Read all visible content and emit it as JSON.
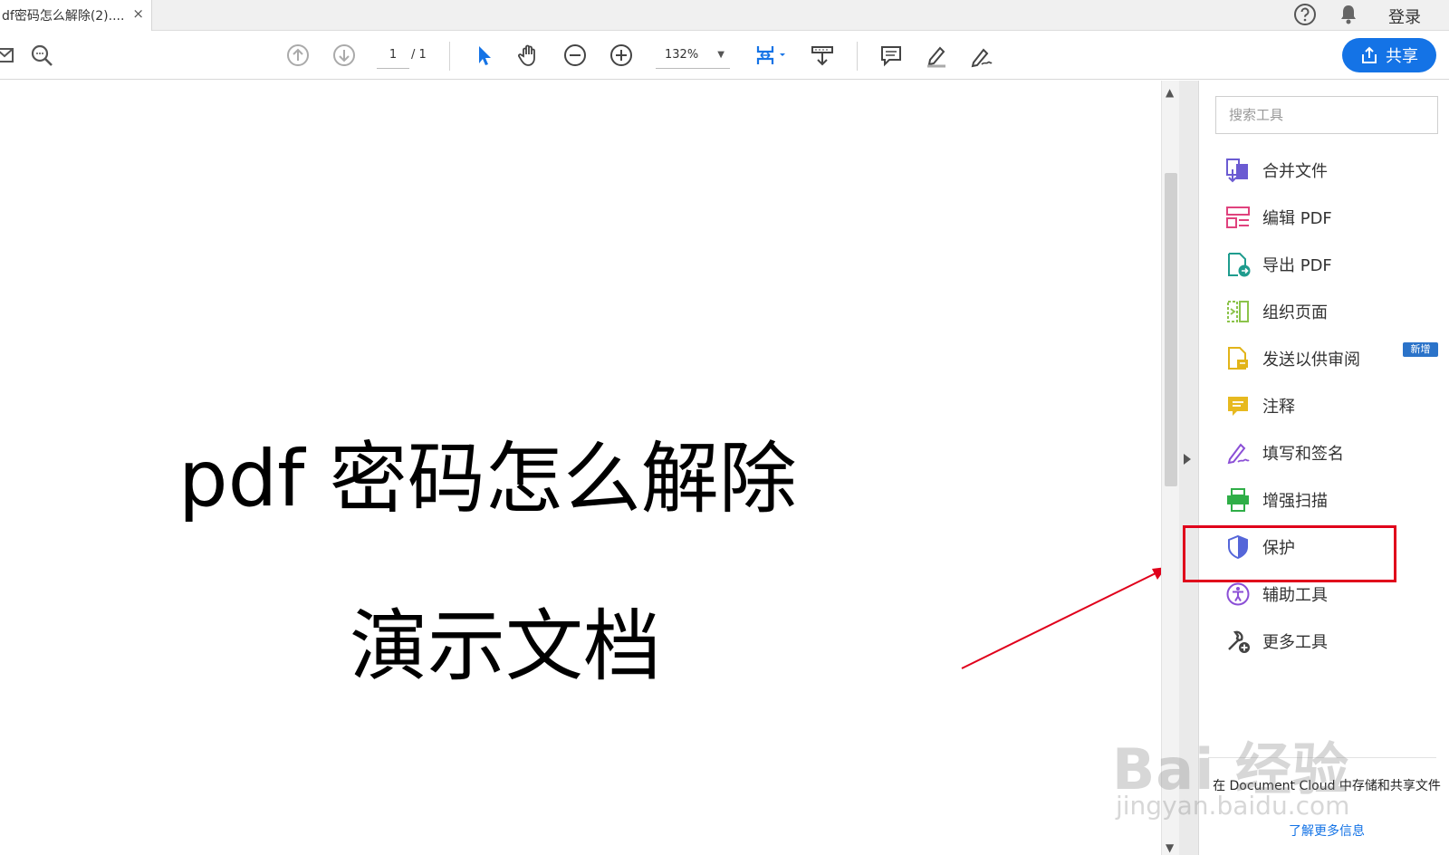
{
  "tab": {
    "title": "df密码怎么解除(2)....",
    "close": "×"
  },
  "header": {
    "login": "登录"
  },
  "toolbar": {
    "page_current": "1",
    "page_total": "/ 1",
    "zoom": "132%",
    "share_label": "共享"
  },
  "document": {
    "line1": "pdf 密码怎么解除",
    "line2": "演示文档"
  },
  "panel": {
    "search_placeholder": "搜索工具",
    "tools": [
      {
        "label": "合并文件",
        "icon": "combine-files-icon",
        "color": "#6b5bd2"
      },
      {
        "label": "编辑 PDF",
        "icon": "edit-pdf-icon",
        "color": "#e0427d"
      },
      {
        "label": "导出 PDF",
        "icon": "export-pdf-icon",
        "color": "#1f9c8e"
      },
      {
        "label": "组织页面",
        "icon": "organize-pages-icon",
        "color": "#8bc34a"
      },
      {
        "label": "发送以供审阅",
        "icon": "send-review-icon",
        "color": "#e2b419"
      },
      {
        "label": "注释",
        "icon": "comment-icon",
        "color": "#e7b91f"
      },
      {
        "label": "填写和签名",
        "icon": "fill-sign-icon",
        "color": "#8b4fd6"
      },
      {
        "label": "增强扫描",
        "icon": "enhance-scan-icon",
        "color": "#2fae47"
      },
      {
        "label": "保护",
        "icon": "protect-shield-icon",
        "color": "#5566d9"
      },
      {
        "label": "辅助工具",
        "icon": "accessibility-icon",
        "color": "#8b4fd6"
      },
      {
        "label": "更多工具",
        "icon": "more-tools-icon",
        "color": "#444444"
      }
    ],
    "new_badge": "新增",
    "cloud_text": "在 Document Cloud 中存储和共享文件",
    "cloud_link": "了解更多信息"
  },
  "watermark": {
    "big": "Bai 经验",
    "small": "jingyan.baidu.com"
  },
  "colors": {
    "accent": "#1473e6",
    "highlight": "#e0001b"
  }
}
